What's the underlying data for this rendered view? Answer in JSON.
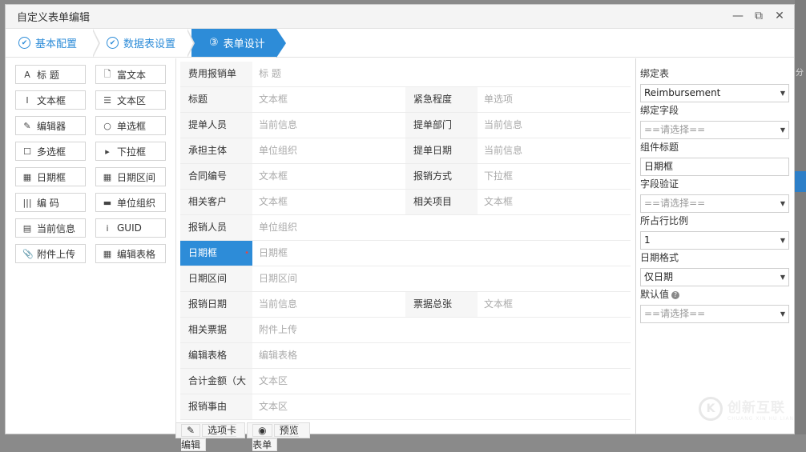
{
  "window": {
    "title": "自定义表单编辑",
    "min_icon": "minimize-icon",
    "max_icon": "maximize-icon",
    "close_icon": "close-icon"
  },
  "steps": [
    {
      "label": "基本配置",
      "icon": "✔"
    },
    {
      "label": "数据表设置",
      "icon": "✔"
    },
    {
      "label": "表单设计",
      "icon": "③"
    }
  ],
  "components": [
    {
      "label": "标 题",
      "glyph": "A",
      "icon": "title-icon"
    },
    {
      "label": "富文本",
      "glyph": "🗋",
      "icon": "document-icon"
    },
    {
      "label": "文本框",
      "glyph": "I",
      "icon": "text-cursor-icon"
    },
    {
      "label": "文本区",
      "glyph": "☰",
      "icon": "text-area-icon"
    },
    {
      "label": "编辑器",
      "glyph": "✎",
      "icon": "edit-icon"
    },
    {
      "label": "单选框",
      "glyph": "○",
      "icon": "radio-icon"
    },
    {
      "label": "多选框",
      "glyph": "☐",
      "icon": "checkbox-icon"
    },
    {
      "label": "下拉框",
      "glyph": "▸",
      "icon": "dropdown-icon"
    },
    {
      "label": "日期框",
      "glyph": "▦",
      "icon": "calendar-icon"
    },
    {
      "label": "日期区间",
      "glyph": "▦",
      "icon": "calendar-range-icon"
    },
    {
      "label": "编 码",
      "glyph": "|||",
      "icon": "barcode-icon"
    },
    {
      "label": "单位组织",
      "glyph": "▬",
      "icon": "organization-icon"
    },
    {
      "label": "当前信息",
      "glyph": "▤",
      "icon": "info-book-icon"
    },
    {
      "label": "GUID",
      "glyph": "i",
      "icon": "info-icon"
    },
    {
      "label": "附件上传",
      "glyph": "📎",
      "icon": "paperclip-icon"
    },
    {
      "label": "编辑表格",
      "glyph": "▦",
      "icon": "table-icon"
    }
  ],
  "form_rows": [
    {
      "cells": [
        {
          "label": "费用报销单",
          "value": "标 题"
        }
      ]
    },
    {
      "cells": [
        {
          "label": "标题",
          "value": "文本框"
        },
        {
          "label": "紧急程度",
          "value": "单选项"
        }
      ]
    },
    {
      "cells": [
        {
          "label": "提单人员",
          "value": "当前信息"
        },
        {
          "label": "提单部门",
          "value": "当前信息"
        }
      ]
    },
    {
      "cells": [
        {
          "label": "承担主体",
          "value": "单位组织"
        },
        {
          "label": "提单日期",
          "value": "当前信息"
        }
      ]
    },
    {
      "cells": [
        {
          "label": "合同编号",
          "value": "文本框"
        },
        {
          "label": "报销方式",
          "value": "下拉框"
        }
      ]
    },
    {
      "cells": [
        {
          "label": "相关客户",
          "value": "文本框"
        },
        {
          "label": "相关项目",
          "value": "文本框"
        }
      ]
    },
    {
      "cells": [
        {
          "label": "报销人员",
          "value": "单位组织"
        }
      ]
    },
    {
      "cells": [
        {
          "label": "日期框",
          "value": "日期框"
        }
      ],
      "selected": true
    },
    {
      "cells": [
        {
          "label": "日期区间",
          "value": "日期区间"
        }
      ]
    },
    {
      "cells": [
        {
          "label": "报销日期",
          "value": "当前信息"
        },
        {
          "label": "票据总张",
          "value": "文本框"
        }
      ]
    },
    {
      "cells": [
        {
          "label": "相关票据",
          "value": "附件上传"
        }
      ]
    },
    {
      "cells": [
        {
          "label": "编辑表格",
          "value": "编辑表格"
        }
      ]
    },
    {
      "cells": [
        {
          "label": "合计金额（大",
          "value": "文本区"
        }
      ]
    },
    {
      "cells": [
        {
          "label": "报销事由",
          "value": "文本区"
        }
      ]
    }
  ],
  "bottom_tabs": {
    "tab_editor": "选项卡编辑",
    "tab_editor_icon": "✎",
    "preview": "预览表单",
    "preview_icon": "◉"
  },
  "properties": {
    "bind_table_label": "绑定表",
    "bind_table_value": "Reimbursement",
    "bind_field_label": "绑定字段",
    "bind_field_value": "==请选择==",
    "title_label": "组件标题",
    "title_value": "日期框",
    "validation_label": "字段验证",
    "validation_value": "==请选择==",
    "ratio_label": "所占行比例",
    "ratio_value": "1",
    "date_format_label": "日期格式",
    "date_format_value": "仅日期",
    "default_label": "默认值",
    "default_value": "==请选择=="
  },
  "edge": {
    "fen": "分"
  },
  "watermark": {
    "name": "创新互联",
    "sub": "CHUANG XIN HU LIAN",
    "logo": "K"
  }
}
